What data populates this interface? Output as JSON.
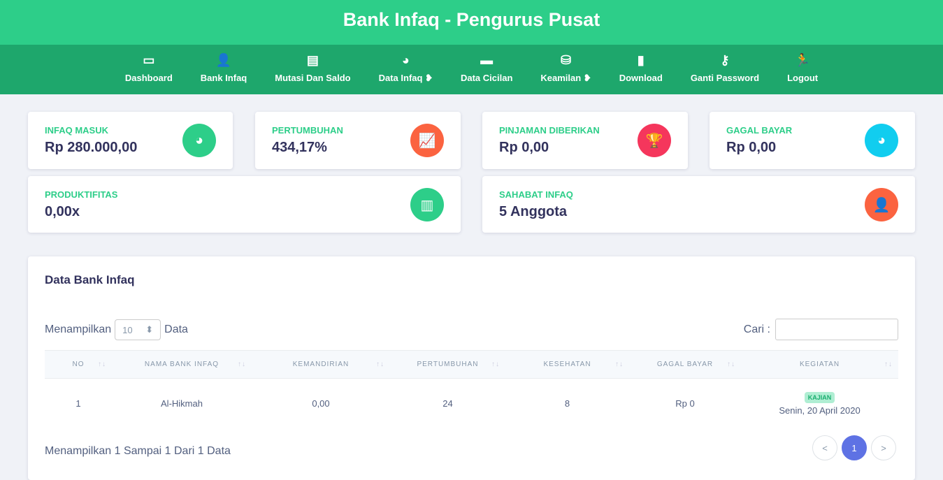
{
  "header": {
    "title": "Bank Infaq - Pengurus Pusat"
  },
  "nav": [
    {
      "label": "Dashboard",
      "icon": "▭"
    },
    {
      "label": "Bank Infaq",
      "icon": "👤"
    },
    {
      "label": "Mutasi Dan Saldo",
      "icon": "▤"
    },
    {
      "label": "Data Infaq ❥",
      "icon": "◕"
    },
    {
      "label": "Data Cicilan",
      "icon": "▬"
    },
    {
      "label": "Keamilan ❥",
      "icon": "⛁"
    },
    {
      "label": "Download",
      "icon": "▮"
    },
    {
      "label": "Ganti Password",
      "icon": "⚷"
    },
    {
      "label": "Logout",
      "icon": "🏃"
    }
  ],
  "stats": [
    {
      "label": "Infaq Masuk",
      "value": "Rp 280.000,00",
      "icon": "◕",
      "color": "#2dce89"
    },
    {
      "label": "Pertumbuhan",
      "value": "434,17%",
      "icon": "📈",
      "color": "#fb6340"
    },
    {
      "label": "Pinjaman Diberikan",
      "value": "Rp 0,00",
      "icon": "🏆",
      "color": "#f5365c"
    },
    {
      "label": "Gagal Bayar",
      "value": "Rp 0,00",
      "icon": "◕",
      "color": "#11cdef"
    },
    {
      "label": "Produktifitas",
      "value": "0,00x",
      "icon": "▥",
      "color": "#2dce89"
    },
    {
      "label": "Sahabat Infaq",
      "value": "5 Anggota",
      "icon": "👤",
      "color": "#fb6340"
    }
  ],
  "table": {
    "title": "Data Bank Infaq",
    "show_prefix": "Menampilkan",
    "show_value": "10",
    "show_suffix": "Data",
    "search_label": "Cari :",
    "columns": [
      "NO",
      "NAMA BANK INFAQ",
      "KEMANDIRIAN",
      "PERTUMBUHAN",
      "KESEHATAN",
      "GAGAL BAYAR",
      "KEGIATAN"
    ],
    "rows": [
      {
        "no": "1",
        "nama": "Al-Hikmah",
        "kemandirian": "0,00",
        "pertumbuhan": "24",
        "kesehatan": "8",
        "gagal_bayar": "Rp 0",
        "badge": "KAJIAN",
        "tanggal": "Senin, 20 April 2020"
      }
    ],
    "info": "Menampilkan 1 Sampai 1 Dari 1 Data",
    "pagination": {
      "prev": "<",
      "current": "1",
      "next": ">"
    }
  }
}
